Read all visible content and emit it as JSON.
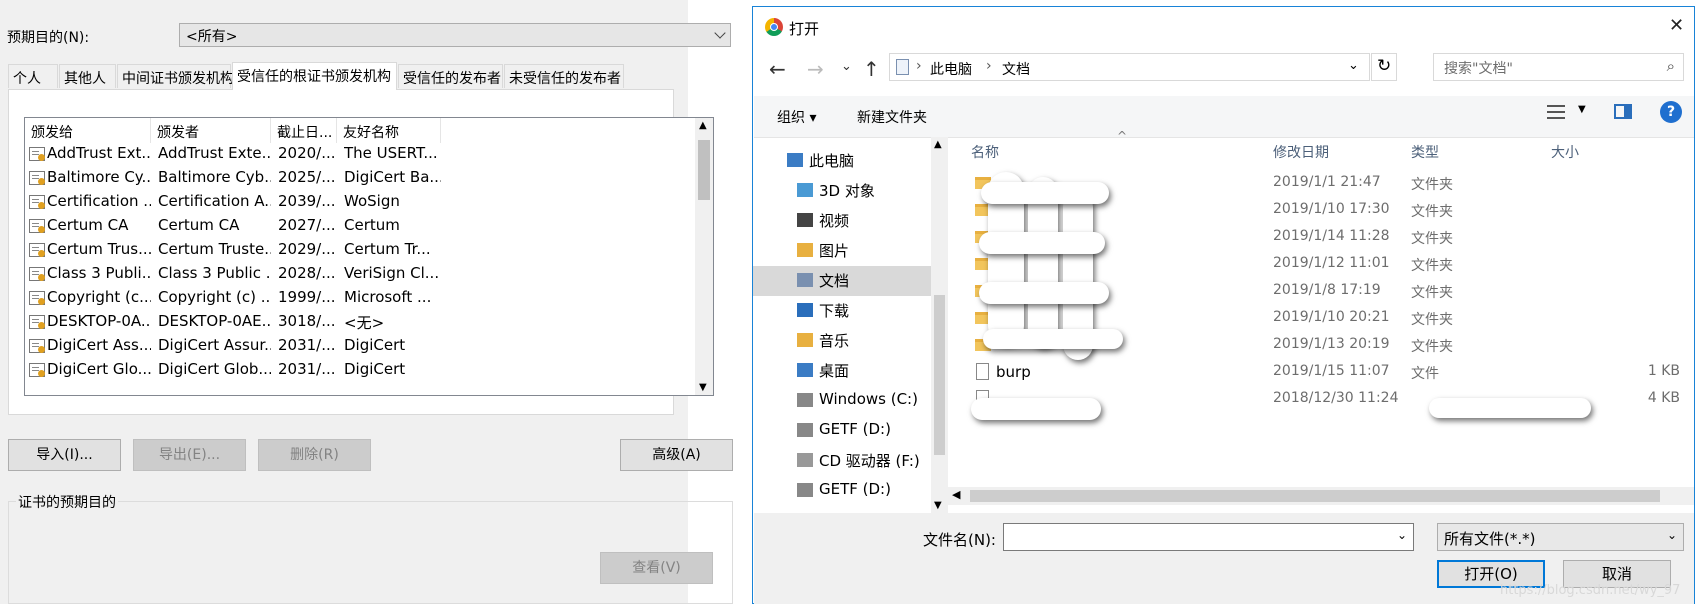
{
  "certmgr": {
    "purpose_label": "预期目的(N):",
    "purpose_value": "<所有>",
    "tabs": [
      "个人",
      "其他人",
      "中间证书颁发机构",
      "受信任的根证书颁发机构",
      "受信任的发布者",
      "未受信任的发布者"
    ],
    "active_tab": 3,
    "columns": [
      "颁发给",
      "颁发者",
      "截止日...",
      "友好名称"
    ],
    "rows": [
      [
        "AddTrust Ext...",
        "AddTrust Exte...",
        "2020/...",
        "The USERT..."
      ],
      [
        "Baltimore Cy...",
        "Baltimore Cyb...",
        "2025/...",
        "DigiCert Ba..."
      ],
      [
        "Certification ...",
        "Certification A...",
        "2039/...",
        "WoSign"
      ],
      [
        "Certum CA",
        "Certum CA",
        "2027/...",
        "Certum"
      ],
      [
        "Certum Trus...",
        "Certum Truste...",
        "2029/...",
        "Certum Tr..."
      ],
      [
        "Class 3 Publi...",
        "Class 3 Public ...",
        "2028/...",
        "VeriSign Cl..."
      ],
      [
        "Copyright (c...",
        "Copyright (c) ...",
        "1999/...",
        "Microsoft ..."
      ],
      [
        "DESKTOP-0A...",
        "DESKTOP-0AE...",
        "3018/...",
        "<无>"
      ],
      [
        "DigiCert Ass...",
        "DigiCert Assur...",
        "2031/...",
        "DigiCert"
      ],
      [
        "DigiCert Glo...",
        "DigiCert Glob...",
        "2031/...",
        "DigiCert"
      ]
    ],
    "buttons": {
      "import": "导入(I)...",
      "export": "导出(E)...",
      "remove": "删除(R)",
      "advanced": "高级(A)",
      "view": "查看(V)"
    },
    "purposes_group_label": "证书的预期目的"
  },
  "dialog": {
    "title": "打开",
    "close_glyph": "✕",
    "breadcrumb": [
      "此电脑",
      "文档"
    ],
    "search_placeholder": "搜索\"文档\"",
    "toolbar": {
      "organize": "组织 ▾",
      "new_folder": "新建文件夹"
    },
    "nav": [
      {
        "label": "此电脑",
        "icon": "computer-icon",
        "indent": 0
      },
      {
        "label": "3D 对象",
        "icon": "cube-icon",
        "indent": 1
      },
      {
        "label": "视频",
        "icon": "video-icon",
        "indent": 1
      },
      {
        "label": "图片",
        "icon": "picture-icon",
        "indent": 1
      },
      {
        "label": "文档",
        "icon": "document-icon",
        "indent": 1
      },
      {
        "label": "下载",
        "icon": "download-icon",
        "indent": 1
      },
      {
        "label": "音乐",
        "icon": "music-icon",
        "indent": 1
      },
      {
        "label": "桌面",
        "icon": "desktop-icon",
        "indent": 1
      },
      {
        "label": "Windows (C:)",
        "icon": "drive-icon",
        "indent": 1
      },
      {
        "label": "GETF (D:)",
        "icon": "drive-icon",
        "indent": 1
      },
      {
        "label": "CD 驱动器 (F:)",
        "icon": "cd-icon",
        "indent": 1
      },
      {
        "label": "GETF (D:)",
        "icon": "drive-icon",
        "indent": 1
      }
    ],
    "selected_nav": 4,
    "columns": [
      "名称",
      "修改日期",
      "类型",
      "大小"
    ],
    "files": [
      {
        "name": "",
        "date": "2019/1/1 21:47",
        "type": "文件夹",
        "size": "",
        "icon": "folder-icon"
      },
      {
        "name": "",
        "date": "2019/1/10 17:30",
        "type": "文件夹",
        "size": "",
        "icon": "folder-icon"
      },
      {
        "name": "",
        "date": "2019/1/14 11:28",
        "type": "文件夹",
        "size": "",
        "icon": "folder-icon"
      },
      {
        "name": "",
        "date": "2019/1/12 11:01",
        "type": "文件夹",
        "size": "",
        "icon": "folder-icon"
      },
      {
        "name": "",
        "date": "2019/1/8 17:19",
        "type": "文件夹",
        "size": "",
        "icon": "folder-icon"
      },
      {
        "name": "",
        "date": "2019/1/10 20:21",
        "type": "文件夹",
        "size": "",
        "icon": "folder-icon"
      },
      {
        "name": "",
        "date": "2019/1/13 20:19",
        "type": "文件夹",
        "size": "",
        "icon": "folder-icon"
      },
      {
        "name": "burp",
        "date": "2019/1/15 11:07",
        "type": "文件",
        "size": "1 KB",
        "icon": "file-icon"
      },
      {
        "name": "",
        "date": "2018/12/30 11:24",
        "type": "",
        "size": "4 KB",
        "icon": "file-icon"
      }
    ],
    "filename_label": "文件名(N):",
    "filename_value": "",
    "filetype_value": "所有文件(*.*)",
    "open_button": "打开(O)",
    "cancel_button": "取消"
  },
  "watermark": "https://blog.csdn.net/wy_97"
}
